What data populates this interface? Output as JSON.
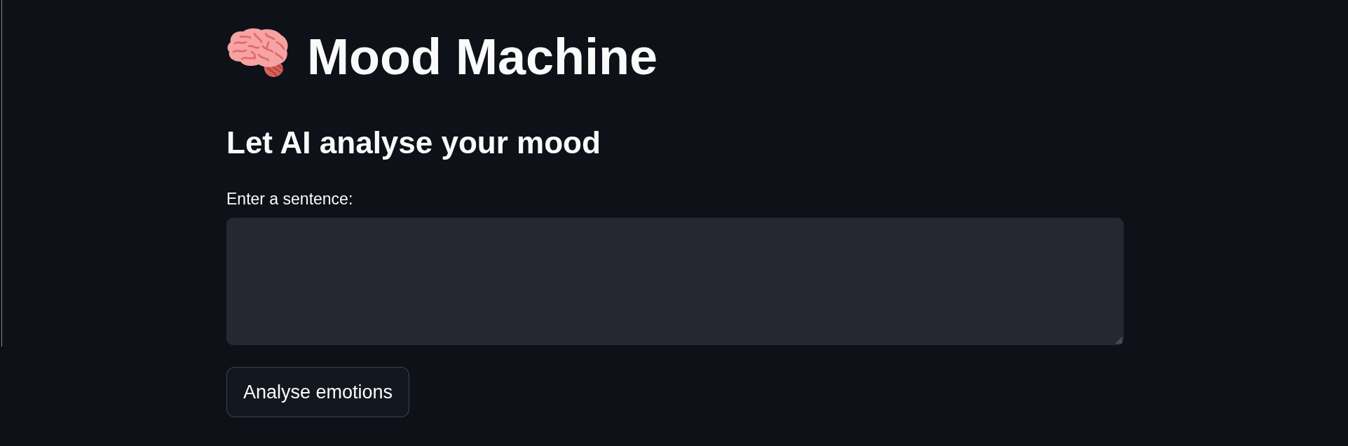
{
  "title": {
    "text": "Mood Machine"
  },
  "subheader": {
    "text": "Let AI analyse your mood"
  },
  "text_input": {
    "label": "Enter a sentence:"
  },
  "button": {
    "label": "Analyse emotions"
  }
}
